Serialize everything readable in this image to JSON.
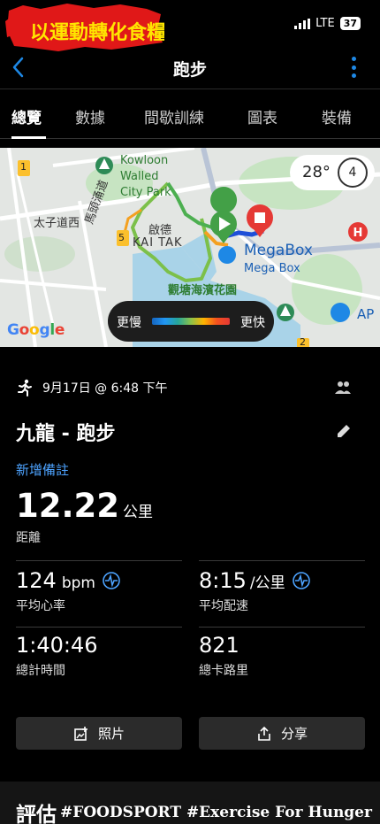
{
  "status_bar": {
    "logo_text": "以運動轉化食糧！",
    "network": "LTE",
    "battery": "37"
  },
  "header": {
    "title": "跑步"
  },
  "tabs": [
    {
      "label": "總覽",
      "active": true
    },
    {
      "label": "數據"
    },
    {
      "label": "間歇訓練"
    },
    {
      "label": "圖表"
    },
    {
      "label": "裝備"
    }
  ],
  "map": {
    "labels": {
      "kowloon": "Kowloon",
      "walled": "Walled",
      "city_park": "City Park",
      "tai_tzu": "太子道西",
      "ma_tau": "馬頭涌道",
      "kai_tak_cn": "啟德",
      "kai_tak_en": "KAI TAK",
      "megabox": "MegaBox",
      "megabox_small": "Mega Box",
      "promenade": "觀塘海濱花園",
      "ap": "AP",
      "num1": "1",
      "num5": "5",
      "num2": "2"
    },
    "temperature": "28°",
    "compass": "4",
    "legend_slow": "更慢",
    "legend_fast": "更快",
    "google": [
      "G",
      "o",
      "o",
      "g",
      "l",
      "e"
    ],
    "colors": {
      "water": "#a9d3e8",
      "land": "#e3e6e3",
      "park": "#c7e4c2",
      "route_slow": "#1e4fd8",
      "route_fast": "#f4a020",
      "route_mid": "#7cc04a"
    }
  },
  "activity": {
    "date": "9月17日 @ 6:48 下午",
    "title": "九龍 - 跑步",
    "add_note": "新增備註",
    "distance": {
      "value": "12.22",
      "unit": "公里",
      "label": "距離"
    },
    "heart_rate": {
      "value": "124",
      "unit": "bpm",
      "label": "平均心率"
    },
    "pace": {
      "value": "8:15",
      "unit": "/公里",
      "label": "平均配速"
    },
    "total_time": {
      "value": "1:40:46",
      "label": "總計時間"
    },
    "calories": {
      "value": "821",
      "label": "總卡路里"
    },
    "photos_button": "照片",
    "share_button": "分享"
  },
  "evaluation": {
    "title": "評估",
    "tags": "#FOODSPORT #Exercise For Hunger"
  }
}
